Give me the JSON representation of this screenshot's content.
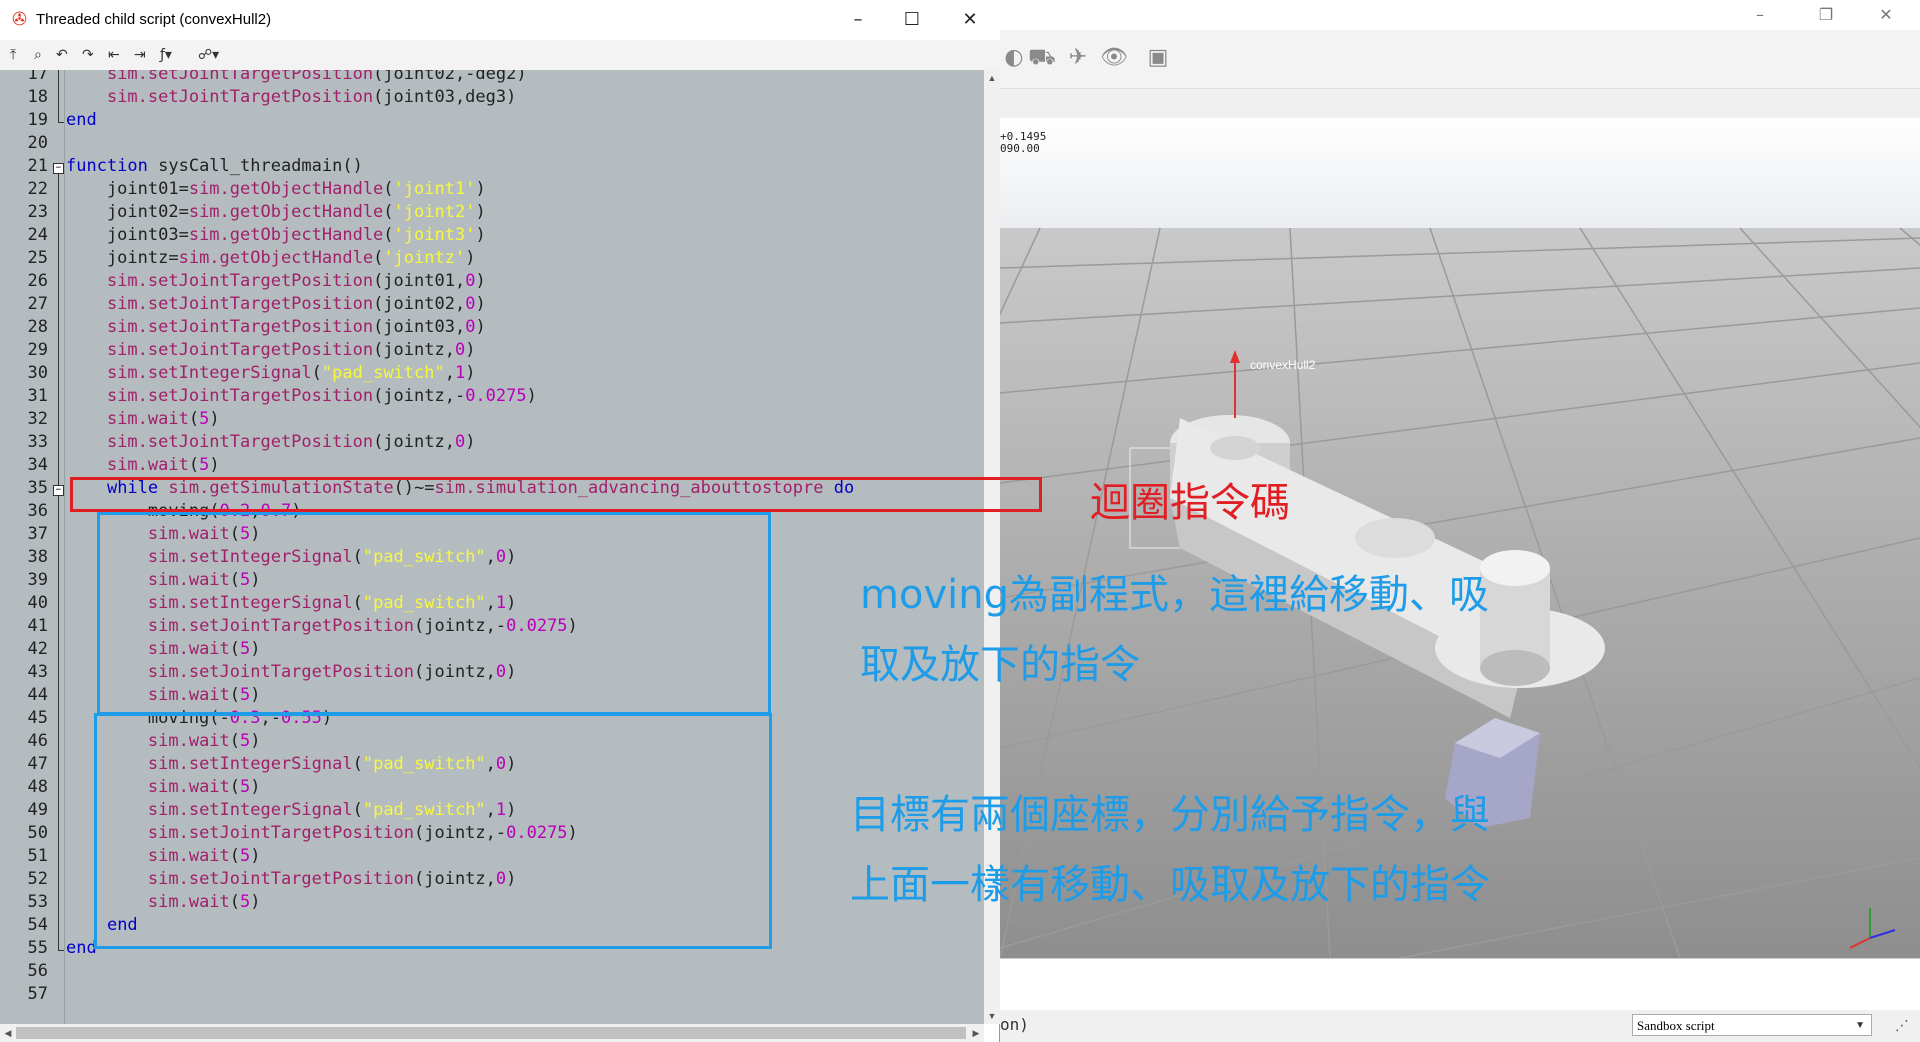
{
  "editor": {
    "title": "Threaded child script (convexHull2)",
    "lines": [
      {
        "n": "17",
        "tokens": [
          {
            "t": "    "
          },
          {
            "t": "sim.setJointTargetPosition",
            "c": "fn"
          },
          {
            "t": "(joint02,-deg2)"
          }
        ]
      },
      {
        "n": "18",
        "tokens": [
          {
            "t": "    "
          },
          {
            "t": "sim.setJointTargetPosition",
            "c": "fn"
          },
          {
            "t": "(joint03,deg3)"
          }
        ]
      },
      {
        "n": "19",
        "tokens": [
          {
            "t": "end",
            "c": "kw"
          }
        ]
      },
      {
        "n": "20",
        "tokens": []
      },
      {
        "n": "21",
        "tokens": [
          {
            "t": "function",
            "c": "kw"
          },
          {
            "t": " sysCall_threadmain()"
          }
        ]
      },
      {
        "n": "22",
        "tokens": [
          {
            "t": "    joint01="
          },
          {
            "t": "sim.getObjectHandle",
            "c": "fn"
          },
          {
            "t": "("
          },
          {
            "t": "'joint1'",
            "c": "str"
          },
          {
            "t": ")"
          }
        ]
      },
      {
        "n": "23",
        "tokens": [
          {
            "t": "    joint02="
          },
          {
            "t": "sim.getObjectHandle",
            "c": "fn"
          },
          {
            "t": "("
          },
          {
            "t": "'joint2'",
            "c": "str"
          },
          {
            "t": ")"
          }
        ]
      },
      {
        "n": "24",
        "tokens": [
          {
            "t": "    joint03="
          },
          {
            "t": "sim.getObjectHandle",
            "c": "fn"
          },
          {
            "t": "("
          },
          {
            "t": "'joint3'",
            "c": "str"
          },
          {
            "t": ")"
          }
        ]
      },
      {
        "n": "25",
        "tokens": [
          {
            "t": "    jointz="
          },
          {
            "t": "sim.getObjectHandle",
            "c": "fn"
          },
          {
            "t": "("
          },
          {
            "t": "'jointz'",
            "c": "str"
          },
          {
            "t": ")"
          }
        ]
      },
      {
        "n": "26",
        "tokens": [
          {
            "t": "    "
          },
          {
            "t": "sim.setJointTargetPosition",
            "c": "fn"
          },
          {
            "t": "(joint01,"
          },
          {
            "t": "0",
            "c": "num"
          },
          {
            "t": ")"
          }
        ]
      },
      {
        "n": "27",
        "tokens": [
          {
            "t": "    "
          },
          {
            "t": "sim.setJointTargetPosition",
            "c": "fn"
          },
          {
            "t": "(joint02,"
          },
          {
            "t": "0",
            "c": "num"
          },
          {
            "t": ")"
          }
        ]
      },
      {
        "n": "28",
        "tokens": [
          {
            "t": "    "
          },
          {
            "t": "sim.setJointTargetPosition",
            "c": "fn"
          },
          {
            "t": "(joint03,"
          },
          {
            "t": "0",
            "c": "num"
          },
          {
            "t": ")"
          }
        ]
      },
      {
        "n": "29",
        "tokens": [
          {
            "t": "    "
          },
          {
            "t": "sim.setJointTargetPosition",
            "c": "fn"
          },
          {
            "t": "(jointz,"
          },
          {
            "t": "0",
            "c": "num"
          },
          {
            "t": ")"
          }
        ]
      },
      {
        "n": "30",
        "tokens": [
          {
            "t": "    "
          },
          {
            "t": "sim.setIntegerSignal",
            "c": "fn"
          },
          {
            "t": "("
          },
          {
            "t": "\"pad_switch\"",
            "c": "str"
          },
          {
            "t": ","
          },
          {
            "t": "1",
            "c": "num"
          },
          {
            "t": ")"
          }
        ]
      },
      {
        "n": "31",
        "tokens": [
          {
            "t": "    "
          },
          {
            "t": "sim.setJointTargetPosition",
            "c": "fn"
          },
          {
            "t": "(jointz,-"
          },
          {
            "t": "0.0275",
            "c": "num"
          },
          {
            "t": ")"
          }
        ]
      },
      {
        "n": "32",
        "tokens": [
          {
            "t": "    "
          },
          {
            "t": "sim.wait",
            "c": "fn"
          },
          {
            "t": "("
          },
          {
            "t": "5",
            "c": "num"
          },
          {
            "t": ")"
          }
        ]
      },
      {
        "n": "33",
        "tokens": [
          {
            "t": "    "
          },
          {
            "t": "sim.setJointTargetPosition",
            "c": "fn"
          },
          {
            "t": "(jointz,"
          },
          {
            "t": "0",
            "c": "num"
          },
          {
            "t": ")"
          }
        ]
      },
      {
        "n": "34",
        "tokens": [
          {
            "t": "    "
          },
          {
            "t": "sim.wait",
            "c": "fn"
          },
          {
            "t": "("
          },
          {
            "t": "5",
            "c": "num"
          },
          {
            "t": ")"
          }
        ]
      },
      {
        "n": "35",
        "tokens": [
          {
            "t": "    "
          },
          {
            "t": "while",
            "c": "kw"
          },
          {
            "t": " "
          },
          {
            "t": "sim.getSimulationState",
            "c": "fn"
          },
          {
            "t": "()~="
          },
          {
            "t": "sim.simulation_advancing_abouttostopre",
            "c": "fn"
          },
          {
            "t": " "
          },
          {
            "t": "do",
            "c": "kw"
          }
        ]
      },
      {
        "n": "36",
        "tokens": [
          {
            "t": "        moving("
          },
          {
            "t": "0.2",
            "c": "num"
          },
          {
            "t": ","
          },
          {
            "t": "0.7",
            "c": "num"
          },
          {
            "t": ")"
          }
        ]
      },
      {
        "n": "37",
        "tokens": [
          {
            "t": "        "
          },
          {
            "t": "sim.wait",
            "c": "fn"
          },
          {
            "t": "("
          },
          {
            "t": "5",
            "c": "num"
          },
          {
            "t": ")"
          }
        ]
      },
      {
        "n": "38",
        "tokens": [
          {
            "t": "        "
          },
          {
            "t": "sim.setIntegerSignal",
            "c": "fn"
          },
          {
            "t": "("
          },
          {
            "t": "\"pad_switch\"",
            "c": "str"
          },
          {
            "t": ","
          },
          {
            "t": "0",
            "c": "num"
          },
          {
            "t": ")"
          }
        ]
      },
      {
        "n": "39",
        "tokens": [
          {
            "t": "        "
          },
          {
            "t": "sim.wait",
            "c": "fn"
          },
          {
            "t": "("
          },
          {
            "t": "5",
            "c": "num"
          },
          {
            "t": ")"
          }
        ]
      },
      {
        "n": "40",
        "tokens": [
          {
            "t": "        "
          },
          {
            "t": "sim.setIntegerSignal",
            "c": "fn"
          },
          {
            "t": "("
          },
          {
            "t": "\"pad_switch\"",
            "c": "str"
          },
          {
            "t": ","
          },
          {
            "t": "1",
            "c": "num"
          },
          {
            "t": ")"
          }
        ]
      },
      {
        "n": "41",
        "tokens": [
          {
            "t": "        "
          },
          {
            "t": "sim.setJointTargetPosition",
            "c": "fn"
          },
          {
            "t": "(jointz,-"
          },
          {
            "t": "0.0275",
            "c": "num"
          },
          {
            "t": ")"
          }
        ]
      },
      {
        "n": "42",
        "tokens": [
          {
            "t": "        "
          },
          {
            "t": "sim.wait",
            "c": "fn"
          },
          {
            "t": "("
          },
          {
            "t": "5",
            "c": "num"
          },
          {
            "t": ")"
          }
        ]
      },
      {
        "n": "43",
        "tokens": [
          {
            "t": "        "
          },
          {
            "t": "sim.setJointTargetPosition",
            "c": "fn"
          },
          {
            "t": "(jointz,"
          },
          {
            "t": "0",
            "c": "num"
          },
          {
            "t": ")"
          }
        ]
      },
      {
        "n": "44",
        "tokens": [
          {
            "t": "        "
          },
          {
            "t": "sim.wait",
            "c": "fn"
          },
          {
            "t": "("
          },
          {
            "t": "5",
            "c": "num"
          },
          {
            "t": ")"
          }
        ]
      },
      {
        "n": "45",
        "tokens": [
          {
            "t": "        moving(-"
          },
          {
            "t": "0.3",
            "c": "num"
          },
          {
            "t": ",-"
          },
          {
            "t": "0.55",
            "c": "num"
          },
          {
            "t": ")"
          }
        ]
      },
      {
        "n": "46",
        "tokens": [
          {
            "t": "        "
          },
          {
            "t": "sim.wait",
            "c": "fn"
          },
          {
            "t": "("
          },
          {
            "t": "5",
            "c": "num"
          },
          {
            "t": ")"
          }
        ]
      },
      {
        "n": "47",
        "tokens": [
          {
            "t": "        "
          },
          {
            "t": "sim.setIntegerSignal",
            "c": "fn"
          },
          {
            "t": "("
          },
          {
            "t": "\"pad_switch\"",
            "c": "str"
          },
          {
            "t": ","
          },
          {
            "t": "0",
            "c": "num"
          },
          {
            "t": ")"
          }
        ]
      },
      {
        "n": "48",
        "tokens": [
          {
            "t": "        "
          },
          {
            "t": "sim.wait",
            "c": "fn"
          },
          {
            "t": "("
          },
          {
            "t": "5",
            "c": "num"
          },
          {
            "t": ")"
          }
        ]
      },
      {
        "n": "49",
        "tokens": [
          {
            "t": "        "
          },
          {
            "t": "sim.setIntegerSignal",
            "c": "fn"
          },
          {
            "t": "("
          },
          {
            "t": "\"pad_switch\"",
            "c": "str"
          },
          {
            "t": ","
          },
          {
            "t": "1",
            "c": "num"
          },
          {
            "t": ")"
          }
        ]
      },
      {
        "n": "50",
        "tokens": [
          {
            "t": "        "
          },
          {
            "t": "sim.setJointTargetPosition",
            "c": "fn"
          },
          {
            "t": "(jointz,-"
          },
          {
            "t": "0.0275",
            "c": "num"
          },
          {
            "t": ")"
          }
        ]
      },
      {
        "n": "51",
        "tokens": [
          {
            "t": "        "
          },
          {
            "t": "sim.wait",
            "c": "fn"
          },
          {
            "t": "("
          },
          {
            "t": "5",
            "c": "num"
          },
          {
            "t": ")"
          }
        ]
      },
      {
        "n": "52",
        "tokens": [
          {
            "t": "        "
          },
          {
            "t": "sim.setJointTargetPosition",
            "c": "fn"
          },
          {
            "t": "(jointz,"
          },
          {
            "t": "0",
            "c": "num"
          },
          {
            "t": ")"
          }
        ]
      },
      {
        "n": "53",
        "tokens": [
          {
            "t": "        "
          },
          {
            "t": "sim.wait",
            "c": "fn"
          },
          {
            "t": "("
          },
          {
            "t": "5",
            "c": "num"
          },
          {
            "t": ")"
          }
        ]
      },
      {
        "n": "54",
        "tokens": [
          {
            "t": "    "
          },
          {
            "t": "end",
            "c": "kw"
          }
        ]
      },
      {
        "n": "55",
        "tokens": [
          {
            "t": "end",
            "c": "kw"
          }
        ]
      },
      {
        "n": "56",
        "tokens": []
      },
      {
        "n": "57",
        "tokens": []
      }
    ]
  },
  "viewport": {
    "readout_line1": "+0.1495",
    "readout_line2": "090.00",
    "object_label": "convexHull2"
  },
  "bottom": {
    "command_fragment": "on)",
    "sandbox_selected": "Sandbox script"
  },
  "annotations": {
    "loop": "迴圈指令碼",
    "move1_line1": "moving為副程式，這裡給移動、吸",
    "move1_line2": "取及放下的指令",
    "move2_line1": "目標有兩個座標，分別給予指令，與",
    "move2_line2": "上面一樣有移動、吸取及放下的指令"
  },
  "colors": {
    "code_bg": "#b4bcc0",
    "keyword": "#0000c8",
    "function": "#a0206a",
    "string": "#f7f740",
    "number": "#b800b8",
    "loop_box": "#e01e24",
    "move_box": "#1e9ce8"
  }
}
